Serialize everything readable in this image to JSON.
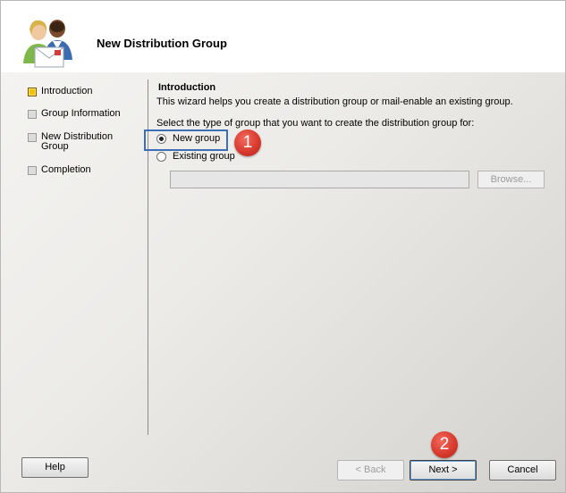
{
  "header": {
    "title": "New Distribution Group",
    "icon": "users-mail-icon"
  },
  "nav": {
    "items": [
      {
        "label": "Introduction",
        "active": true
      },
      {
        "label": "Group Information",
        "active": false
      },
      {
        "label": "New Distribution Group",
        "active": false
      },
      {
        "label": "Completion",
        "active": false
      }
    ]
  },
  "main": {
    "section_title": "Introduction",
    "description": "This wizard helps you create a distribution group or mail-enable an existing group.",
    "select_label": "Select the type of group that you want to create the distribution group for:",
    "options": [
      {
        "label": "New group",
        "checked": true
      },
      {
        "label": "Existing group",
        "checked": false
      }
    ],
    "existing_group_value": "",
    "browse_label": "Browse..."
  },
  "annotations": {
    "badge1": "1",
    "badge2": "2",
    "highlight_color": "#3d6fb6",
    "badge_color": "#d93a2e"
  },
  "footer": {
    "help_label": "Help",
    "back_label": "< Back",
    "next_label": "Next >",
    "cancel_label": "Cancel"
  }
}
